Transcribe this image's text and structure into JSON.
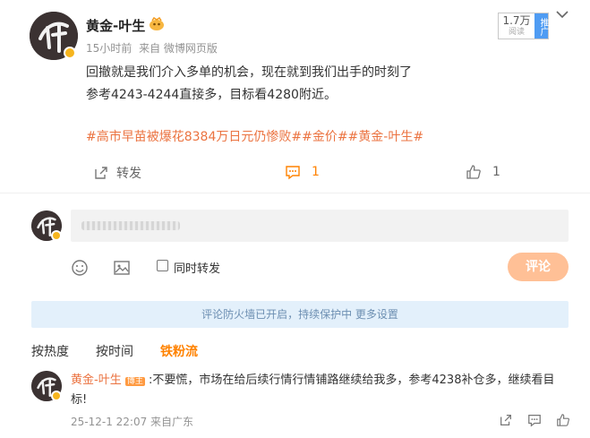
{
  "post": {
    "author": "黄金-叶生",
    "avatar_char": "叶",
    "time": "15小时前",
    "source": "来自 微博网页版",
    "reads": {
      "count": "1.7万",
      "label": "阅读",
      "push": "推广"
    },
    "lines": [
      "回撤就是我们介入多单的机会，现在就到我们出手的时刻了",
      "参考4243-4244直接多，目标看4280附近。"
    ],
    "topics": "#高市早苗被爆花8384万日元仍惨败##金价##黄金-叶生#",
    "actions": {
      "repost": "转发",
      "comment_count": "1",
      "like_count": "1"
    }
  },
  "composer": {
    "checkbox_label": "同时转发",
    "submit": "评论"
  },
  "notice": "评论防火墙已开启，持续保护中 更多设置",
  "sort_tabs": [
    "按热度",
    "按时间",
    "铁粉流"
  ],
  "comment": {
    "author": "黄金-叶生",
    "badge": "博主",
    "text": ":不要慌，市场在给后续行情行情铺路继续给我多，参考4238补仓多，继续看目标!",
    "time": "25-12-1 22:07 来自广东"
  },
  "colors": {
    "accent": "#ff8200",
    "topic": "#eb7340",
    "notice_bg": "#e3f0fb",
    "submit_bg": "#ffc096"
  }
}
